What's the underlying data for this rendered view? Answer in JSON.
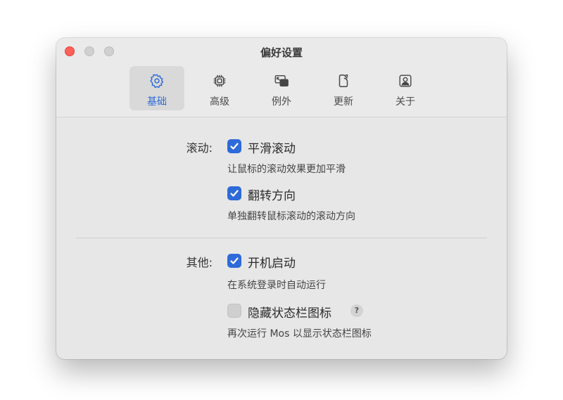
{
  "window": {
    "title": "偏好设置"
  },
  "tabs": [
    {
      "label": "基础",
      "icon": "gear-icon",
      "active": true
    },
    {
      "label": "高级",
      "icon": "chip-icon",
      "active": false
    },
    {
      "label": "例外",
      "icon": "window-exception-icon",
      "active": false
    },
    {
      "label": "更新",
      "icon": "update-icon",
      "active": false
    },
    {
      "label": "关于",
      "icon": "about-icon",
      "active": false
    }
  ],
  "scroll_section": {
    "label": "滚动:",
    "options": [
      {
        "label": "平滑滚动",
        "description": "让鼠标的滚动效果更加平滑",
        "checked": true
      },
      {
        "label": "翻转方向",
        "description": "单独翻转鼠标滚动的滚动方向",
        "checked": true
      }
    ]
  },
  "other_section": {
    "label": "其他:",
    "options": [
      {
        "label": "开机启动",
        "description": "在系统登录时自动运行",
        "checked": true
      },
      {
        "label": "隐藏状态栏图标",
        "description": "再次运行 Mos 以显示状态栏图标",
        "checked": false,
        "help": "?"
      }
    ]
  },
  "colors": {
    "accent": "#2f6ad9",
    "close": "#fe5f57"
  }
}
